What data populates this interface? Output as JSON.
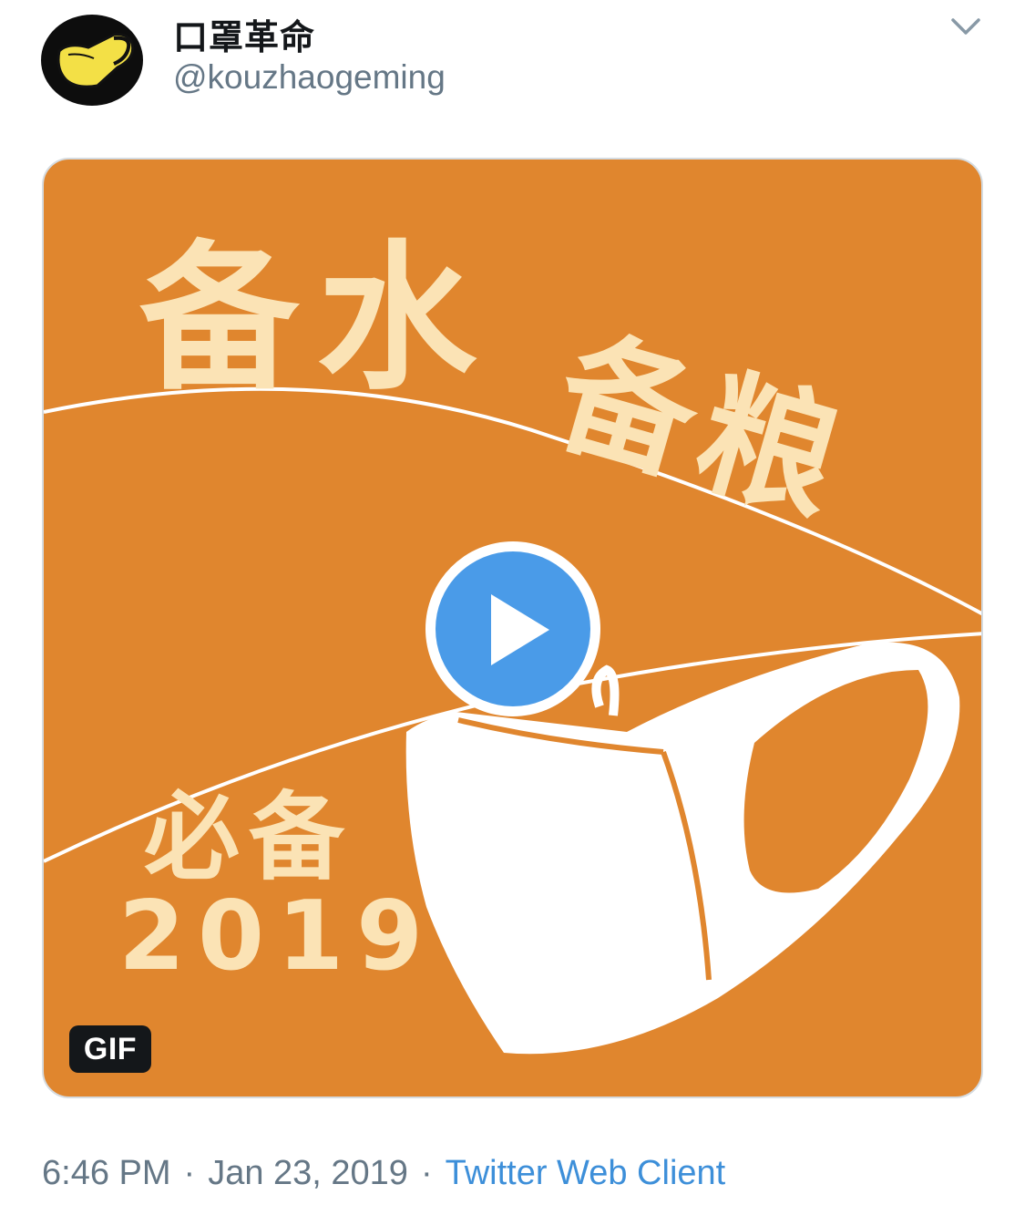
{
  "tweet": {
    "display_name": "口罩革命",
    "handle": "@kouzhaogeming",
    "avatar_icon": "yellow-mask-icon",
    "caret_icon": "chevron-down-icon"
  },
  "media": {
    "badge": "GIF",
    "play_icon": "play-icon",
    "background_color": "#e0862e",
    "text_color": "#fbe3b5",
    "art_text": {
      "line1": "备水",
      "line2": "备粮",
      "line3": "必备",
      "year": "2019"
    }
  },
  "meta": {
    "time": "6:46 PM",
    "separator": "·",
    "date": "Jan 23, 2019",
    "source": "Twitter Web Client"
  },
  "colors": {
    "link": "#3d8fd9",
    "secondary_text": "#657786",
    "play_blue": "#4a9be8"
  }
}
